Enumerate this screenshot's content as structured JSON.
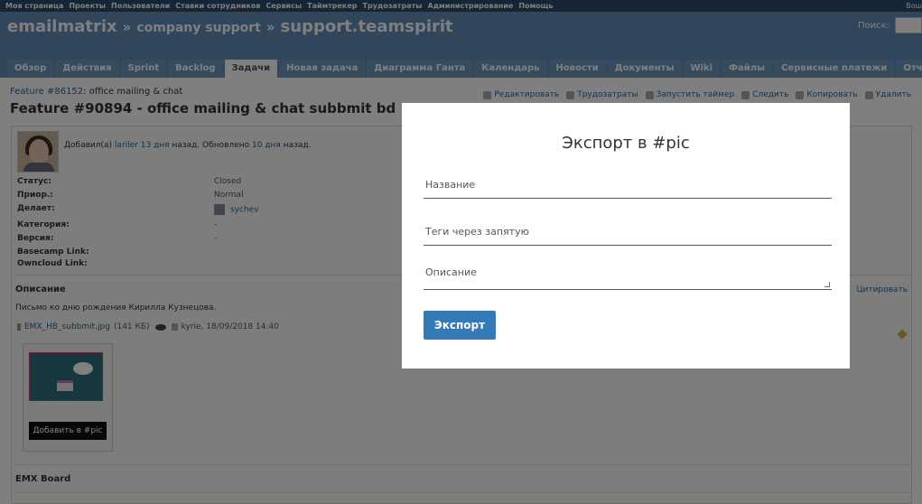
{
  "topbar": {
    "menu": [
      "Моя страница",
      "Проекты",
      "Пользователи",
      "Ставки сотрудников",
      "Сервисы",
      "Таймтрекер",
      "Трудозатраты",
      "Администрирование",
      "Помощь"
    ],
    "right": "Вош"
  },
  "header": {
    "app": "emailmatrix",
    "sep": "»",
    "project": "company support",
    "subproject": "support.teamspirit",
    "search_label": "Поиск:"
  },
  "tabs": [
    "Обзор",
    "Действия",
    "Sprint",
    "Backlog",
    "Задачи",
    "Новая задача",
    "Диаграмма Ганта",
    "Календарь",
    "Новости",
    "Документы",
    "Wiki",
    "Файлы",
    "Сервисные платежи",
    "Отчёт ROI"
  ],
  "issue": {
    "breadcrumb_id": "Feature #86152",
    "breadcrumb_rest": ": office mailing & chat",
    "title": "Feature #90894 - office mailing & chat subbmit bd",
    "actions": [
      "Редактировать",
      "Трудозатраты",
      "Запустить таймер",
      "Следить",
      "Копировать",
      "Удалить"
    ],
    "added_prefix": "Добавил(а)",
    "author": "lariler",
    "added_ago": "13 дня",
    "added_mid": "назад. Обновлено",
    "updated_ago": "10 дня",
    "added_suffix": "назад.",
    "attributes": [
      {
        "key": "Статус:",
        "value": "Closed"
      },
      {
        "key": "Приор.:",
        "value": "Normal"
      },
      {
        "key": "Делает:",
        "value": "sychev"
      },
      {
        "key": "Категория:",
        "value": "-"
      },
      {
        "key": "Версия:",
        "value": "-"
      },
      {
        "key": "Basecamp Link:",
        "value": ""
      },
      {
        "key": "Owncloud Link:",
        "value": ""
      }
    ],
    "description_title": "Описание",
    "quote_label": "Цитировать",
    "description_text": "Письмо ко дню рождения Кирилла Кузнецова.",
    "attachment": {
      "filename": "EMX_HB_subbmit.jpg",
      "size": "(141 КБ)",
      "author_date": "kyrie, 18/09/2018 14:40"
    },
    "thumb_button": "Добавить в #pic",
    "board_title": "EMX Board"
  },
  "modal": {
    "title": "Экспорт в #pic",
    "name_placeholder": "Название",
    "tags_placeholder": "Теги через запятую",
    "description_placeholder": "Описание",
    "export_label": "Экспорт"
  }
}
